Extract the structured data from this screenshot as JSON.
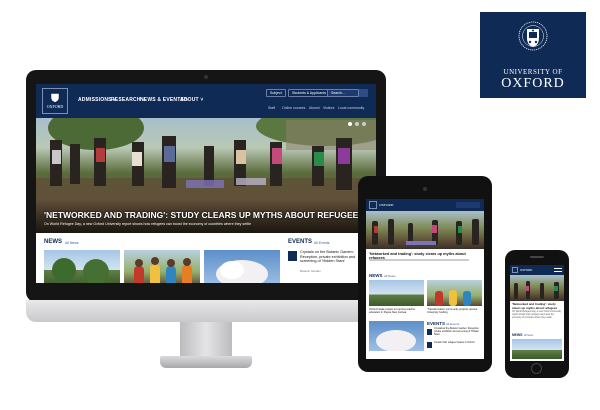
{
  "logo": {
    "line1": "UNIVERSITY OF",
    "line2": "OXFORD"
  },
  "site": {
    "logo_text": "OXFORD",
    "nav": [
      "ADMISSIONS ˅",
      "RESEARCH ˅",
      "NEWS & EVENTS ˅",
      "ABOUT ˅"
    ],
    "top_pills": [
      "Subject",
      "Students & Applicants ˅",
      "Search..."
    ],
    "sub_links": [
      "Staff",
      "Online courses",
      "Alumni",
      "Visitors",
      "Local community"
    ],
    "hero_title": "'NETWORKED AND TRADING': STUDY CLEARS UP MYTHS ABOUT REFUGEES",
    "hero_sub": "On World Refugee Day, a new Oxford University report shows how refugees can boost the economy of countries where they settle",
    "news_heading": "NEWS",
    "news_link": "All News",
    "events_heading": "EVENTS",
    "events_link": "All Events",
    "event_title": "Crystals on the Botanic Garden: Reception, private exhibition and screening of 'Hidden Stars'",
    "event_meta": "Botanic Garden"
  },
  "tablet": {
    "logo_text": "OXFORD",
    "hero_title": "'Networked and trading': study clears up myths about refugees",
    "news_heading": "NEWS",
    "news_link": "All News",
    "caption1": "Oxford Intake project to improve teacher education in Papua New Guinea",
    "caption2": "'Transformative' community projects receive University funding",
    "events_heading": "EVENTS",
    "events_link": "All Events",
    "event1": "Crystals at the Botanic Garden: Reception, private exhibition and screening of 'Hidden Stars'",
    "event2": "Curtain Call: refugee theatre in Oxford"
  },
  "phone": {
    "logo_text": "OXFORD",
    "hero_title": "'Networked and trading': study clears up myths about refugees",
    "hero_sub": "On World Refugee Day, a new Oxford University report shows how refugees can boost the economy of countries where they settle",
    "news_heading": "NEWS",
    "news_link": "All News"
  },
  "colors": {
    "brand": "#0f2a55",
    "link": "#3b5fa0"
  }
}
